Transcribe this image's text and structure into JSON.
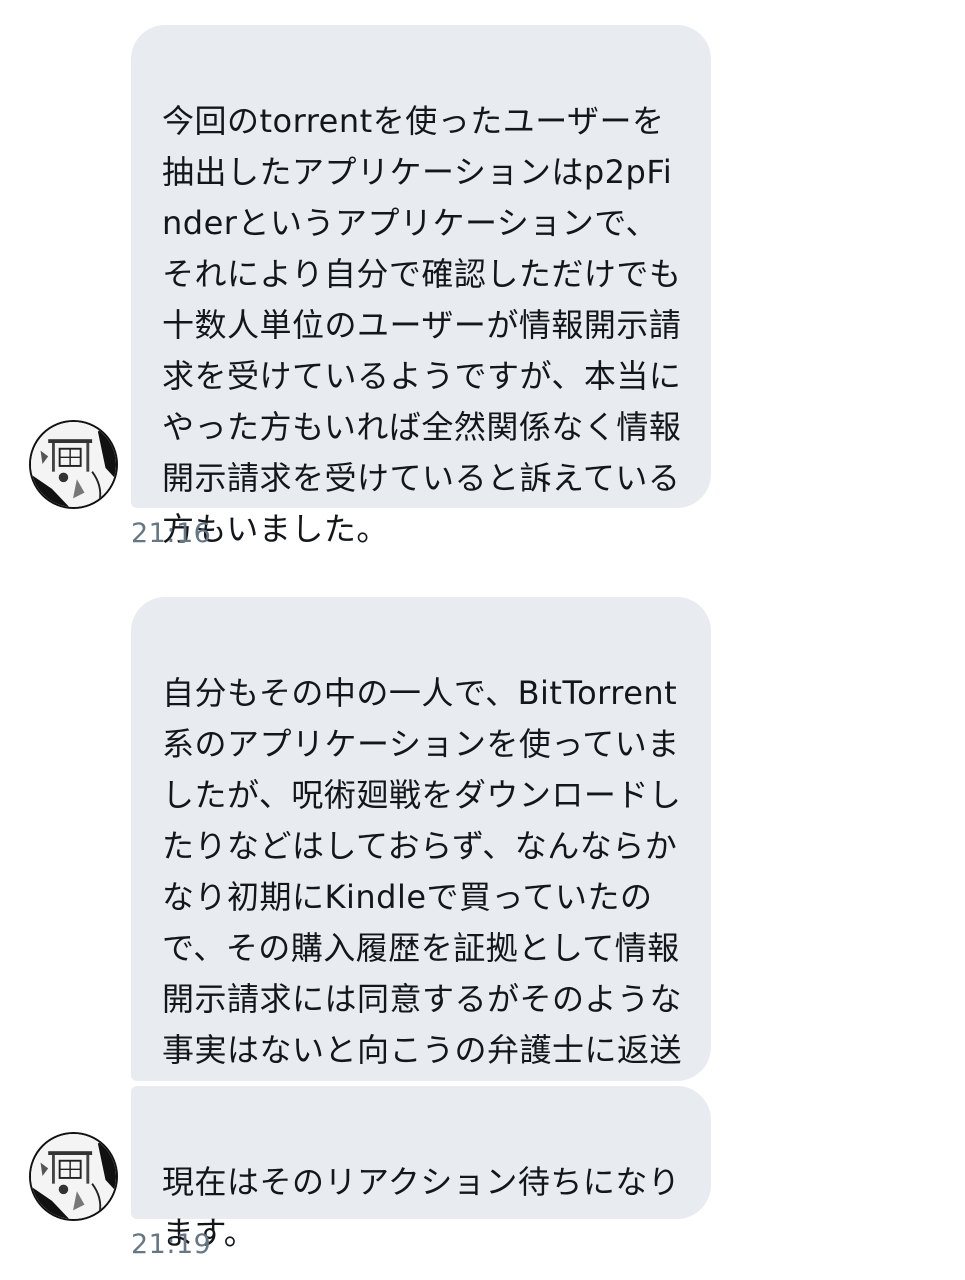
{
  "messages": [
    {
      "text": "今回のtorrentを使ったユーザーを抽出したアプリケーションはp2pFinderというアプリケーションで、それにより自分で確認しただけでも十数人単位のユーザーが情報開示請求を受けているようですが、本当にやった方もいれば全然関係なく情報開示請求を受けていると訴えている方もいました。",
      "time": "21:16"
    },
    {
      "text": "自分もその中の一人で、BitTorrent系のアプリケーションを使っていましたが、呪術廻戦をダウンロードしたりなどはしておらず、なんならかなり初期にKindleで買っていたので、その購入履歴を証拠として情報開示請求には同意するがそのような事実はないと向こうの弁護士に返送しました。"
    },
    {
      "text": "現在はそのリアクション待ちになります。",
      "time": "21:19"
    }
  ],
  "avatar_icon": "manga-drawing-avatar-icon",
  "colors": {
    "bubble": "#e8ecf0",
    "text": "#14171a",
    "timestamp": "#657786"
  }
}
